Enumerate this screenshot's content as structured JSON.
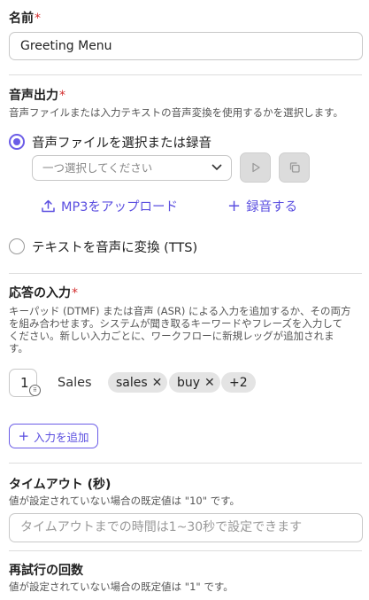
{
  "name_section": {
    "label": "名前",
    "required_mark": "*",
    "value": "Greeting Menu"
  },
  "audio_output": {
    "label": "音声出力",
    "required_mark": "*",
    "description": "音声ファイルまたは入力テキストの音声変換を使用するかを選択します。",
    "option_file": "音声ファイルを選択または録音",
    "select_placeholder": "一つ選択してください",
    "upload_label": "MP3をアップロード",
    "record_label": "録音する",
    "option_tts": "テキストを音声に変換 (TTS)"
  },
  "response_input": {
    "label": "応答の入力",
    "required_mark": "*",
    "description_lines": [
      "キーパッド (DTMF) または音声 (ASR) による入力を追加するか、その両方",
      "を組み合わせます。システムが聞き取るキーワードやフレーズを入力して",
      "ください。新しい入力ごとに、ワークフローに新規レッグが追加されま",
      "す。"
    ],
    "entry": {
      "key": "1",
      "label": "Sales",
      "chips": [
        "sales",
        "buy"
      ],
      "more": "+2"
    },
    "add_button": "入力を追加"
  },
  "timeout": {
    "label": "タイムアウト (秒)",
    "description": "値が設定されていない場合の既定値は \"10\" です。",
    "placeholder": "タイムアウトまでの時間は1~30秒で設定できます"
  },
  "retry": {
    "label": "再試行の回数",
    "description": "値が設定されていない場合の既定値は \"1\" です。"
  },
  "colors": {
    "accent": "#6b5ce7",
    "link": "#5b4fe0",
    "required": "#d32f2f"
  }
}
